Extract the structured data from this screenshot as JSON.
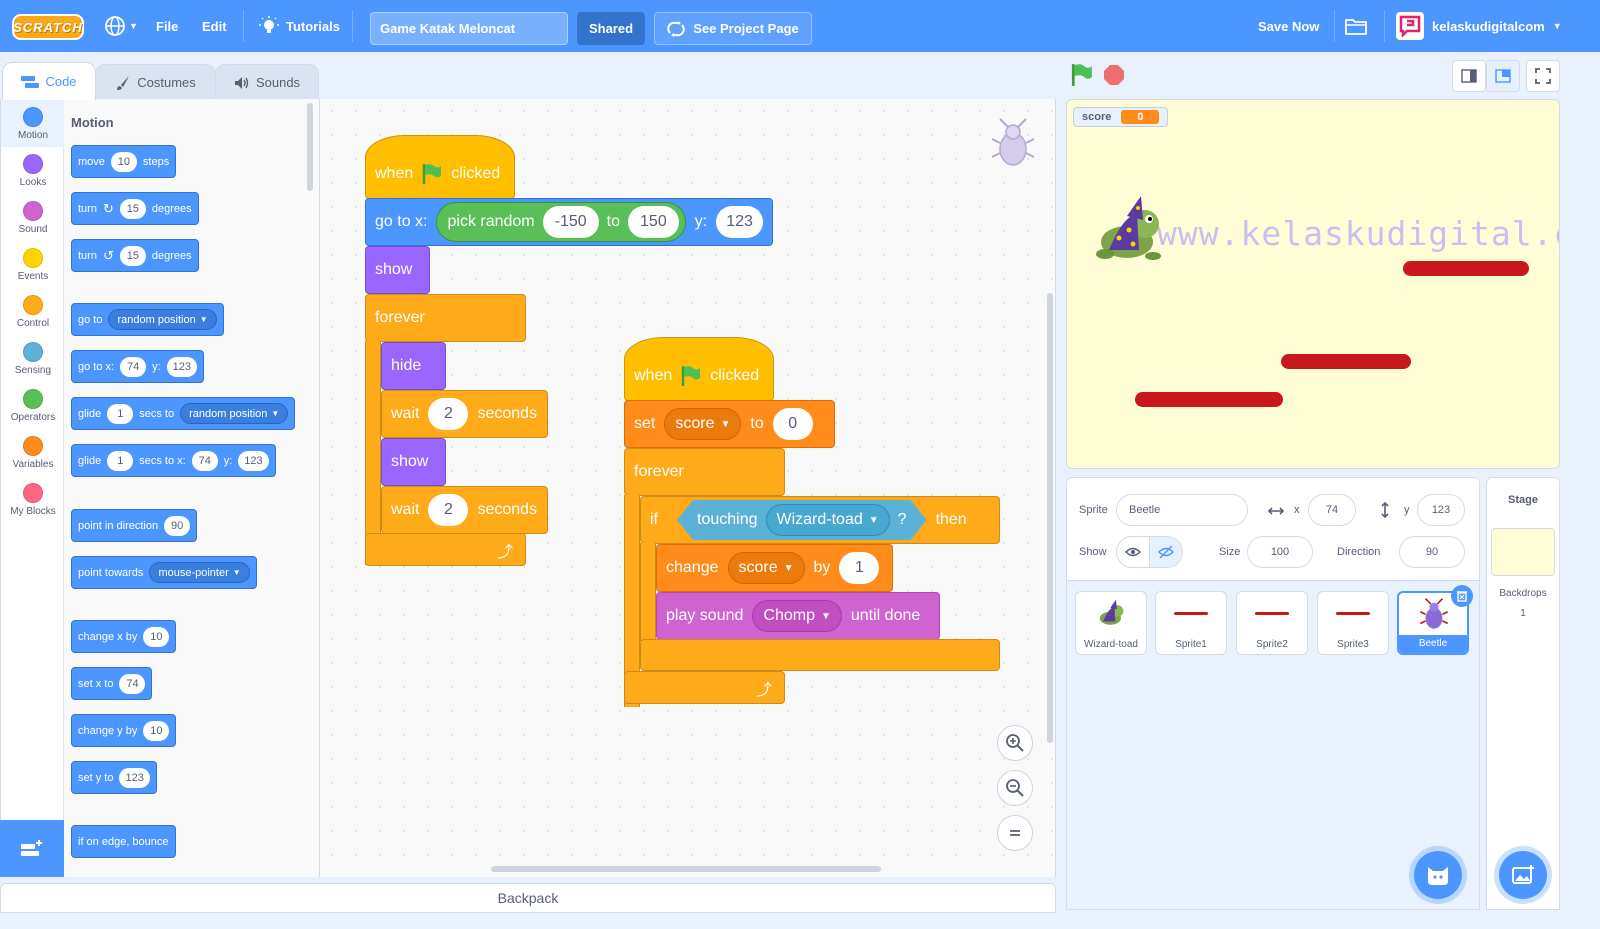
{
  "menubar": {
    "logo_text": "SCRATCH",
    "file": "File",
    "edit": "Edit",
    "tutorials": "Tutorials",
    "project_title": "Game Katak Meloncat",
    "shared": "Shared",
    "see_project_page": "See Project Page",
    "save_now": "Save Now",
    "username": "kelaskudigitalcom"
  },
  "tabs": {
    "code": "Code",
    "costumes": "Costumes",
    "sounds": "Sounds"
  },
  "categories": [
    {
      "label": "Motion",
      "color": "#4c97ff"
    },
    {
      "label": "Looks",
      "color": "#9966ff"
    },
    {
      "label": "Sound",
      "color": "#cf63cf"
    },
    {
      "label": "Events",
      "color": "#ffd500"
    },
    {
      "label": "Control",
      "color": "#ffab19"
    },
    {
      "label": "Sensing",
      "color": "#5cb1d6"
    },
    {
      "label": "Operators",
      "color": "#59c059"
    },
    {
      "label": "Variables",
      "color": "#ff8c1a"
    },
    {
      "label": "My Blocks",
      "color": "#ff6680"
    }
  ],
  "palette": {
    "heading": "Motion",
    "move": [
      "move",
      "10",
      "steps"
    ],
    "turn_cw": [
      "turn",
      "15",
      "degrees"
    ],
    "turn_ccw": [
      "turn",
      "15",
      "degrees"
    ],
    "goto": [
      "go to",
      "random position"
    ],
    "gotoxy": [
      "go to x:",
      "74",
      "y:",
      "123"
    ],
    "glide1": [
      "glide",
      "1",
      "secs to",
      "random position"
    ],
    "glide2": [
      "glide",
      "1",
      "secs to x:",
      "74",
      "y:",
      "123"
    ],
    "point_dir": [
      "point in direction",
      "90"
    ],
    "point_towards": [
      "point towards",
      "mouse-pointer"
    ],
    "change_x": [
      "change x by",
      "10"
    ],
    "set_x": [
      "set x to",
      "74"
    ],
    "change_y": [
      "change y by",
      "10"
    ],
    "set_y": [
      "set y to",
      "123"
    ],
    "bounce": "if on edge, bounce"
  },
  "script1": {
    "when": "when",
    "clicked": "clicked",
    "goto_label": "go to x:",
    "pick_random": "pick random",
    "min": "-150",
    "to": "to",
    "max": "150",
    "y_label": "y:",
    "y": "123",
    "show": "show",
    "forever": "forever",
    "hide": "hide",
    "wait1": [
      "wait",
      "2",
      "seconds"
    ],
    "show2": "show",
    "wait2": [
      "wait",
      "2",
      "seconds"
    ]
  },
  "script2": {
    "when": "when",
    "clicked": "clicked",
    "set": "set",
    "var": "score",
    "to": "to",
    "value": "0",
    "forever": "forever",
    "if": "if",
    "touching": "touching",
    "target": "Wizard-toad",
    "q": "?",
    "then": "then",
    "change": "change",
    "change_var": "score",
    "by": "by",
    "by_value": "1",
    "play_sound": "play sound",
    "sound": "Chomp",
    "until_done": "until done"
  },
  "backpack": "Backpack",
  "stage": {
    "monitor_label": "score",
    "monitor_value": "0",
    "watermark": "www.kelaskudigital.com"
  },
  "sprite_info": {
    "sprite_label": "Sprite",
    "sprite_name": "Beetle",
    "x_label": "x",
    "x": "74",
    "y_label": "y",
    "y": "123",
    "show_label": "Show",
    "size_label": "Size",
    "size": "100",
    "direction_label": "Direction",
    "direction": "90"
  },
  "sprites": [
    "Wizard-toad",
    "Sprite1",
    "Sprite2",
    "Sprite3",
    "Beetle"
  ],
  "stage_panel": {
    "title": "Stage",
    "backdrops_label": "Backdrops",
    "backdrops_count": "1"
  }
}
